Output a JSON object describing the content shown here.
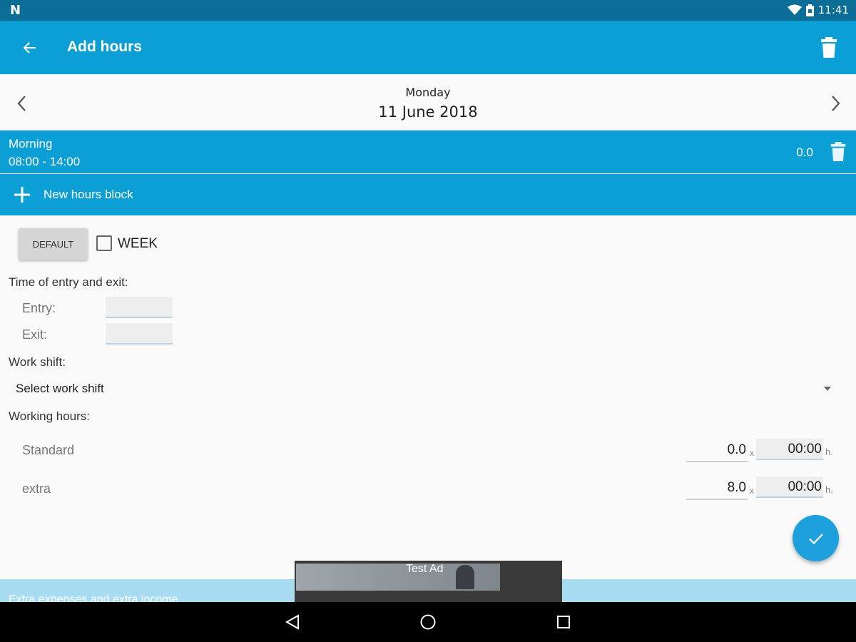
{
  "statusbar": {
    "notification_icon": "N",
    "time": "11:41"
  },
  "appbar": {
    "title": "Add hours"
  },
  "datebar": {
    "day": "Monday",
    "date": "11 June 2018"
  },
  "block": {
    "name": "Morning",
    "time_range": "08:00 - 14:00",
    "value": "0.0"
  },
  "new_block": {
    "label": "New hours block"
  },
  "form": {
    "default_label": "DEFAULT",
    "week_label": "WEEK",
    "week_checked": false,
    "entry_exit_label": "Time of entry and exit:",
    "entry_label": "Entry:",
    "entry_value": "",
    "exit_label": "Exit:",
    "exit_value": "",
    "work_shift_label": "Work shift:",
    "work_shift_selected": "Select work shift",
    "working_hours_label": "Working hours:",
    "rows": [
      {
        "label": "Standard",
        "multiplier": "0.0",
        "x": "x",
        "time": "00:00",
        "unit": "h."
      },
      {
        "label": "extra",
        "multiplier": "8.0",
        "x": "x",
        "time": "00:00",
        "unit": "h."
      }
    ]
  },
  "extra_section": {
    "label": "Extra expenses and extra income"
  },
  "ad": {
    "label": "Test Ad"
  },
  "colors": {
    "primary": "#0c9fd5",
    "statusbar": "#0a6e97",
    "fab": "#1ea0dc",
    "extra_bar": "#a8dcf0"
  }
}
